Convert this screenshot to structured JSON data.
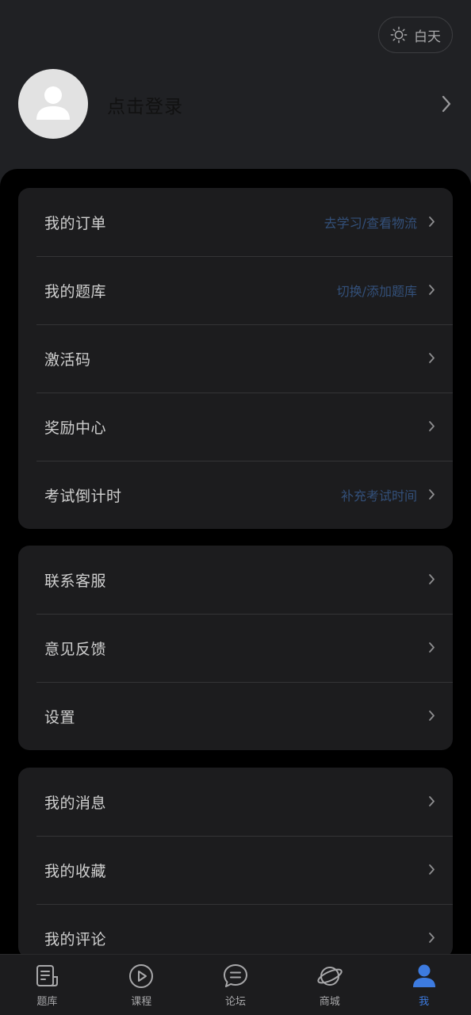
{
  "header": {
    "theme_toggle_label": "白天",
    "login_text": "点击登录"
  },
  "card1": [
    {
      "label": "我的订单",
      "hint": "去学习/查看物流"
    },
    {
      "label": "我的题库",
      "hint": "切换/添加题库"
    },
    {
      "label": "激活码",
      "hint": ""
    },
    {
      "label": "奖励中心",
      "hint": ""
    },
    {
      "label": "考试倒计时",
      "hint": "补充考试时间"
    }
  ],
  "card2": [
    {
      "label": "联系客服",
      "hint": ""
    },
    {
      "label": "意见反馈",
      "hint": ""
    },
    {
      "label": "设置",
      "hint": ""
    }
  ],
  "card3": [
    {
      "label": "我的消息",
      "hint": ""
    },
    {
      "label": "我的收藏",
      "hint": ""
    },
    {
      "label": "我的评论",
      "hint": ""
    }
  ],
  "bottom_nav": [
    {
      "label": "题库",
      "icon": "question-bank-icon"
    },
    {
      "label": "课程",
      "icon": "play-circle-icon"
    },
    {
      "label": "论坛",
      "icon": "chat-bubble-icon"
    },
    {
      "label": "商城",
      "icon": "planet-icon"
    },
    {
      "label": "我",
      "icon": "person-icon",
      "active": true
    }
  ],
  "colors": {
    "accent": "#3d7be0",
    "hint": "#33507a",
    "card_bg": "#1c1c1e",
    "header_bg": "#202124"
  }
}
